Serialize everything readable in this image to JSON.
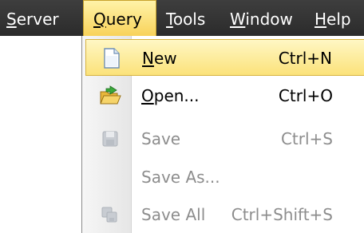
{
  "menubar": {
    "items": [
      {
        "u": "S",
        "rest": "erver"
      },
      {
        "u": "Q",
        "rest": "uery"
      },
      {
        "u": "T",
        "rest": "ools"
      },
      {
        "u": "W",
        "rest": "indow"
      },
      {
        "u": "H",
        "rest": "elp"
      }
    ]
  },
  "query_menu": {
    "items": [
      {
        "u": "N",
        "rest": "ew",
        "shortcut": "Ctrl+N",
        "icon": "new-document-icon",
        "enabled": true
      },
      {
        "u": "O",
        "rest": "pen...",
        "shortcut": "Ctrl+O",
        "icon": "open-folder-icon",
        "enabled": true
      },
      {
        "label": "Save",
        "shortcut": "Ctrl+S",
        "icon": "save-disk-icon",
        "enabled": false
      },
      {
        "label": "Save As...",
        "shortcut": "",
        "icon": "",
        "enabled": false
      },
      {
        "label": "Save All",
        "shortcut": "Ctrl+Shift+S",
        "icon": "save-all-icon",
        "enabled": false
      }
    ]
  },
  "colors": {
    "menubar_bg": "#333333",
    "highlight": "#fbe27a",
    "disabled_text": "#8d8d8d"
  }
}
